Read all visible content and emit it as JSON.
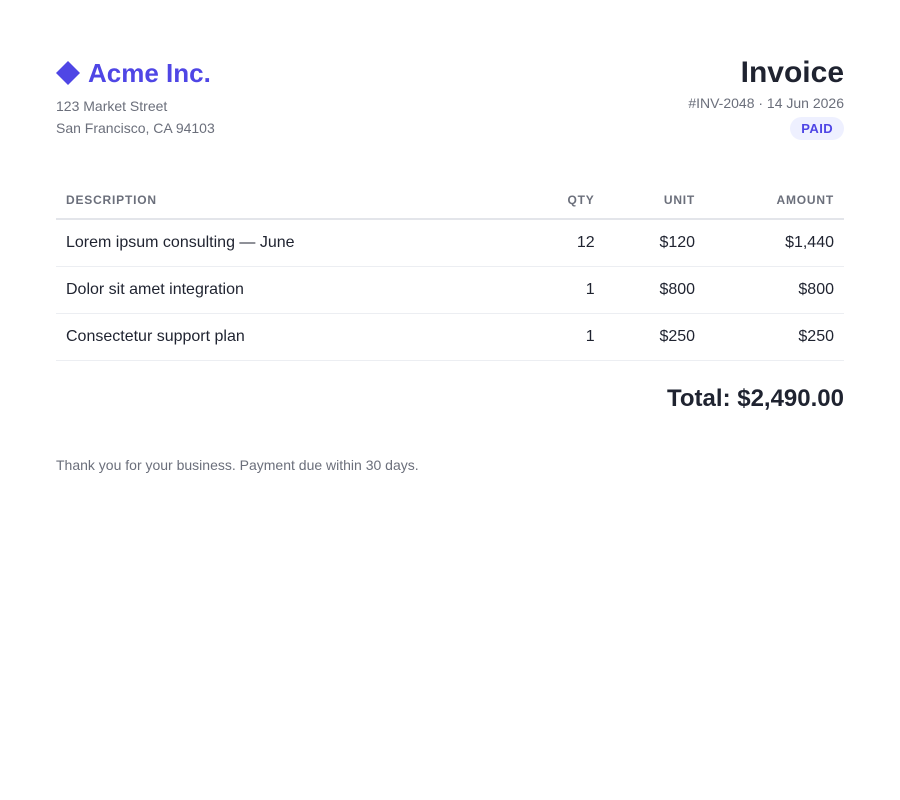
{
  "company": {
    "name": "Acme Inc.",
    "address_line1": "123 Market Street",
    "address_line2": "San Francisco, CA 94103",
    "logo_icon": "diamond-icon",
    "brand_color": "#4f46e5"
  },
  "invoice": {
    "title": "Invoice",
    "subline": "#INV-2048 · 14 Jun 2026",
    "status": "PAID",
    "status_bg": "#eef0ff"
  },
  "table": {
    "headers": {
      "description": "DESCRIPTION",
      "qty": "QTY",
      "unit": "UNIT",
      "amount": "AMOUNT"
    },
    "rows": [
      {
        "description": "Lorem ipsum consulting — June",
        "qty": "12",
        "unit": "$120",
        "amount": "$1,440"
      },
      {
        "description": "Dolor sit amet integration",
        "qty": "1",
        "unit": "$800",
        "amount": "$800"
      },
      {
        "description": "Consectetur support plan",
        "qty": "1",
        "unit": "$250",
        "amount": "$250"
      }
    ]
  },
  "total": "Total: $2,490.00",
  "footer": "Thank you for your business. Payment due within 30 days."
}
